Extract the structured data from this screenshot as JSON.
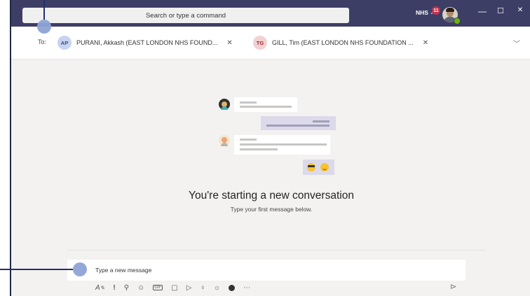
{
  "titlebar": {
    "search_placeholder": "Search or type a command",
    "org_label": "NHS",
    "notification_count": "11",
    "minimize_glyph": "—",
    "maximize_glyph": "☐",
    "close_glyph": "✕"
  },
  "to_bar": {
    "label": "To:",
    "recipients": [
      {
        "initials": "AP",
        "name": "PURANI, Akkash (EAST LONDON NHS FOUND...",
        "avatar_color": "#c7d3ef",
        "initials_color": "#3b4a8a"
      },
      {
        "initials": "TG",
        "name": "GILL, Tim (EAST LONDON NHS FOUNDATION ...",
        "avatar_color": "#f1d1d3",
        "initials_color": "#a4262c"
      }
    ],
    "remove_glyph": "✕",
    "expand_glyph": "﹀"
  },
  "empty_state": {
    "title": "You're starting a new conversation",
    "subtitle": "Type your first message below."
  },
  "composer": {
    "placeholder": "Type a new message",
    "tools": [
      "format-icon",
      "important-icon",
      "attach-icon",
      "emoji-icon",
      "gif-icon",
      "sticker-icon",
      "meet-icon",
      "praise-icon",
      "light-icon",
      "loop-icon",
      "more-icon"
    ],
    "send_icon": "send-icon"
  },
  "colors": {
    "titlebar": "#3d3e66",
    "canvas": "#f3f2f1",
    "accent": "#8ea3d6"
  }
}
